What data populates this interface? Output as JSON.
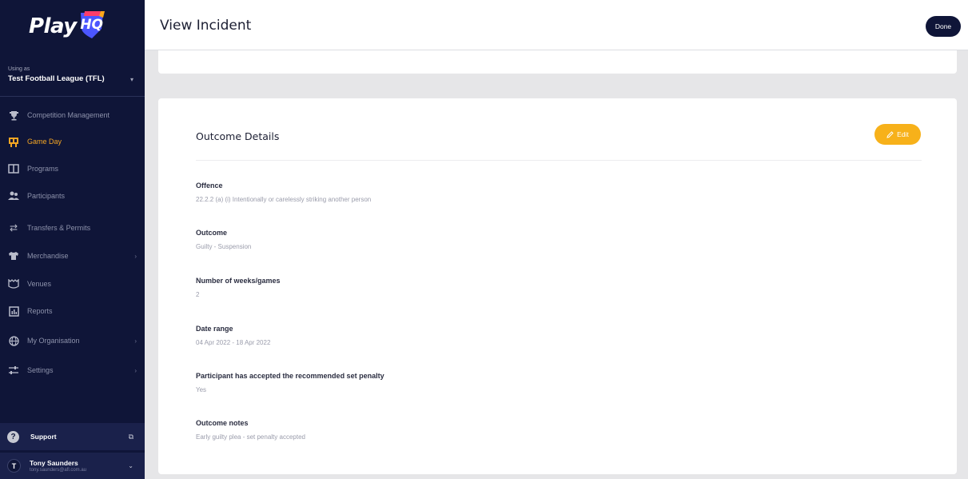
{
  "sidebar": {
    "logo_text": "Play",
    "logo_badge": "HQ",
    "using_as_label": "Using as",
    "org_name": "Test Football League (TFL)",
    "items": [
      {
        "label": "Competition Management",
        "icon": "trophy-icon"
      },
      {
        "label": "Game Day",
        "icon": "scoreboard-icon",
        "active": true
      },
      {
        "label": "Programs",
        "icon": "book-icon"
      },
      {
        "label": "Participants",
        "icon": "people-icon"
      },
      {
        "label": "Transfers & Permits",
        "icon": "transfer-icon"
      },
      {
        "label": "Merchandise",
        "icon": "shirt-icon"
      },
      {
        "label": "Venues",
        "icon": "stadium-icon"
      },
      {
        "label": "Reports",
        "icon": "reports-icon"
      },
      {
        "label": "My Organisation",
        "icon": "globe-icon"
      },
      {
        "label": "Settings",
        "icon": "sliders-icon"
      }
    ],
    "support_label": "Support",
    "user": {
      "initial": "T",
      "name": "Tony Saunders",
      "email": "tony.saunders@afl.com.au"
    }
  },
  "header": {
    "title": "View Incident",
    "done_label": "Done"
  },
  "outcome": {
    "title": "Outcome Details",
    "edit_label": "Edit",
    "fields": [
      {
        "label": "Offence",
        "value": "22.2.2 (a) (i) Intentionally or carelessly striking another person"
      },
      {
        "label": "Outcome",
        "value": "Guilty - Suspension"
      },
      {
        "label": "Number of weeks/games",
        "value": "2"
      },
      {
        "label": "Date range",
        "value": "04 Apr 2022 - 18 Apr 2022"
      },
      {
        "label": "Participant has accepted the recommended set penalty",
        "value": "Yes"
      },
      {
        "label": "Outcome notes",
        "value": "Early guilty plea - set penalty accepted"
      }
    ]
  },
  "colors": {
    "sidebar_bg": "#0f1538",
    "accent": "#f5a623",
    "edit_button": "#f7b11a"
  }
}
